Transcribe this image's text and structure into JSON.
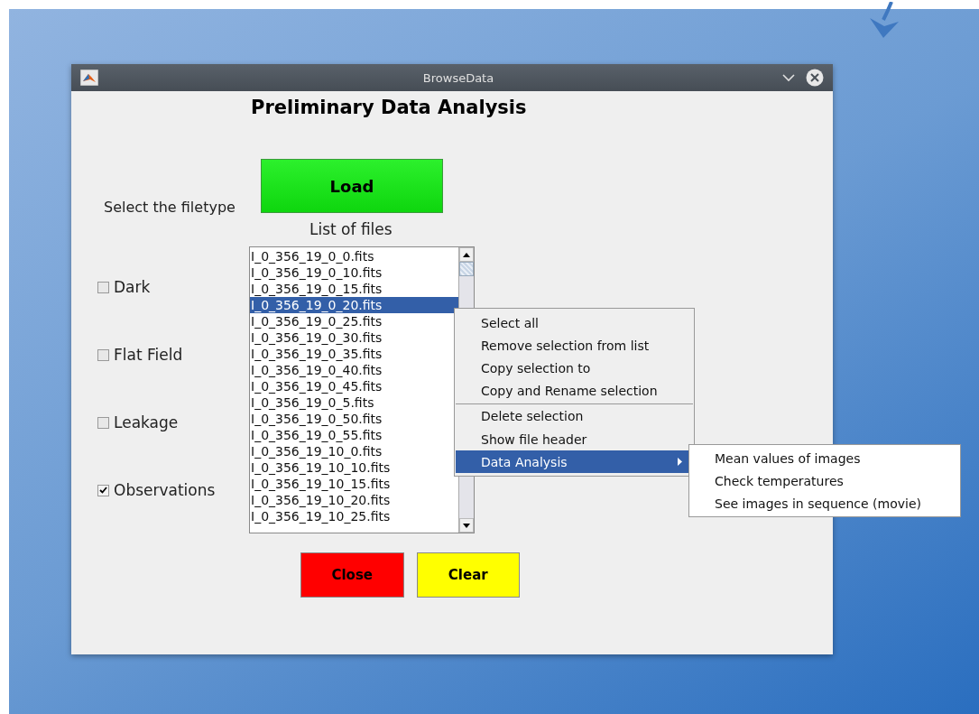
{
  "window": {
    "title": "BrowseData"
  },
  "heading": "Preliminary Data Analysis",
  "load_button": "Load",
  "filetype_label": "Select the filetype",
  "filetypes": [
    {
      "label": "Dark",
      "checked": false
    },
    {
      "label": "Flat Field",
      "checked": false
    },
    {
      "label": "Leakage",
      "checked": false
    },
    {
      "label": "Observations",
      "checked": true
    }
  ],
  "list_label": "List of files",
  "files": [
    {
      "name": "I_0_356_19_0_0.fits",
      "selected": false
    },
    {
      "name": "I_0_356_19_0_10.fits",
      "selected": false
    },
    {
      "name": "I_0_356_19_0_15.fits",
      "selected": false
    },
    {
      "name": "I_0_356_19_0_20.fits",
      "selected": true
    },
    {
      "name": "I_0_356_19_0_25.fits",
      "selected": false
    },
    {
      "name": "I_0_356_19_0_30.fits",
      "selected": false
    },
    {
      "name": "I_0_356_19_0_35.fits",
      "selected": false
    },
    {
      "name": "I_0_356_19_0_40.fits",
      "selected": false
    },
    {
      "name": "I_0_356_19_0_45.fits",
      "selected": false
    },
    {
      "name": "I_0_356_19_0_5.fits",
      "selected": false
    },
    {
      "name": "I_0_356_19_0_50.fits",
      "selected": false
    },
    {
      "name": "I_0_356_19_0_55.fits",
      "selected": false
    },
    {
      "name": "I_0_356_19_10_0.fits",
      "selected": false
    },
    {
      "name": "I_0_356_19_10_10.fits",
      "selected": false
    },
    {
      "name": "I_0_356_19_10_15.fits",
      "selected": false
    },
    {
      "name": "I_0_356_19_10_20.fits",
      "selected": false
    },
    {
      "name": "I_0_356_19_10_25.fits",
      "selected": false
    }
  ],
  "buttons": [
    {
      "label": "Close",
      "color": "#ff0000"
    },
    {
      "label": "Clear",
      "color": "#ffff00"
    }
  ],
  "context_menu": {
    "items": [
      {
        "label": "Select all",
        "selected": false,
        "separator_before": false,
        "has_submenu": false
      },
      {
        "label": "Remove selection from list",
        "selected": false,
        "separator_before": false,
        "has_submenu": false
      },
      {
        "label": "Copy selection to",
        "selected": false,
        "separator_before": false,
        "has_submenu": false
      },
      {
        "label": "Copy and Rename selection",
        "selected": false,
        "separator_before": false,
        "has_submenu": false
      },
      {
        "label": "Delete selection",
        "selected": false,
        "separator_before": true,
        "has_submenu": false
      },
      {
        "label": "Show file header",
        "selected": false,
        "separator_before": false,
        "has_submenu": false
      },
      {
        "label": "Data Analysis",
        "selected": true,
        "separator_before": false,
        "has_submenu": true
      }
    ],
    "submenu": [
      {
        "label": "Mean values of images"
      },
      {
        "label": "Check temperatures"
      },
      {
        "label": "See images in sequence (movie)"
      }
    ]
  }
}
